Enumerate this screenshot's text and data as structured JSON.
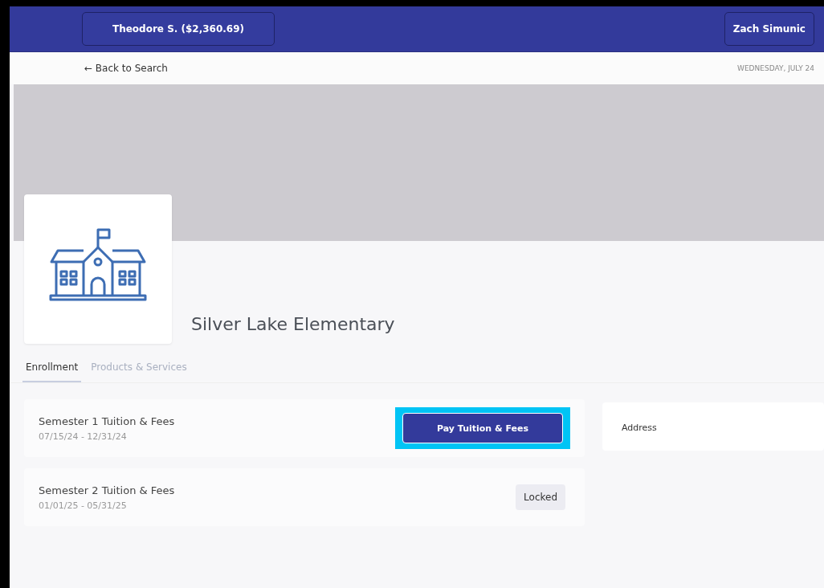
{
  "header": {
    "account_button": "Theodore S. ($2,360.69)",
    "user_button": "Zach Simunic"
  },
  "back_link": "← Back to Search",
  "date": "WEDNESDAY, JULY 24",
  "school": {
    "name": "Silver Lake Elementary"
  },
  "tabs": [
    {
      "label": "Enrollment",
      "selected": true
    },
    {
      "label": "Products & Services",
      "selected": false
    }
  ],
  "sessions": [
    {
      "title": "Semester 1 Tuition & Fees",
      "dates": "07/15/24 - 12/31/24",
      "kind": "pay",
      "action": "Pay Tuition & Fees",
      "highlighted": true
    },
    {
      "title": "Semester 2 Tuition & Fees",
      "dates": "01/01/25 - 05/31/25",
      "kind": "locked",
      "action": "Locked",
      "highlighted": false
    }
  ],
  "side_panel": {
    "label": "Address"
  }
}
